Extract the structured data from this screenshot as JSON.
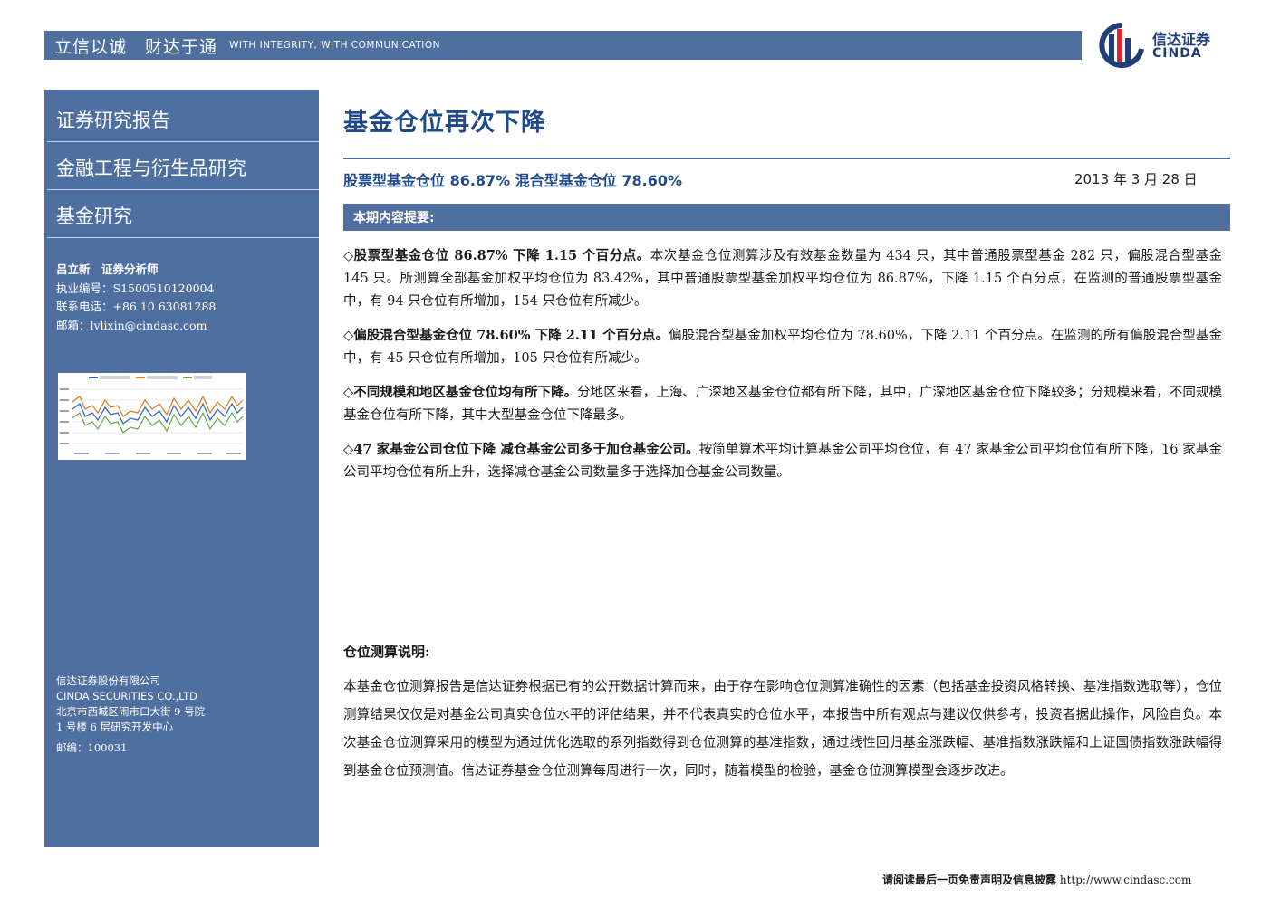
{
  "header": {
    "slogan_cn": "立信以诚　财达于通",
    "slogan_en": "WITH INTEGRITY, WITH COMMUNICATION",
    "logo_cn": "信达证券",
    "logo_en": "CINDA",
    "logo_colors": {
      "blue": "#1f3f7a",
      "red": "#d9272e"
    }
  },
  "sidebar": {
    "titles": [
      "证券研究报告",
      "金融工程与衍生品研究",
      "基金研究"
    ],
    "analyst": {
      "name_line": "吕立新　证券分析师",
      "license": "执业编号：S1500510120004",
      "phone": "联系电话：+86 10 63081288",
      "email": "邮箱：lvlixin@cindasc.com"
    },
    "company": {
      "name_cn": "信达证券股份有限公司",
      "name_en": "CINDA SECURITIES CO.,LTD",
      "address1": "北京市西城区闹市口大街 9 号院",
      "address2": "1 号楼 6 层研究开发中心",
      "postcode": "邮编：100031"
    }
  },
  "report": {
    "title": "基金仓位再次下降",
    "subtitle": "股票型基金仓位 86.87%  混合型基金仓位 78.60%",
    "date": "2013 年 3 月 28 日",
    "summary_heading": "本期内容提要:",
    "bullets": [
      {
        "lead": "◇股票型基金仓位 86.87% 下降 1.15 个百分点。",
        "text": "本次基金仓位测算涉及有效基金数量为 434 只，其中普通股票型基金 282 只，偏股混合型基金 145 只。所测算全部基金加权平均仓位为 83.42%，其中普通股票型基金加权平均仓位为 86.87%，下降 1.15 个百分点，在监测的普通股票型基金中，有 94 只仓位有所增加，154 只仓位有所减少。"
      },
      {
        "lead": "◇偏股混合型基金仓位 78.60% 下降 2.11 个百分点。",
        "text": "偏股混合型基金加权平均仓位为 78.60%，下降 2.11 个百分点。在监测的所有偏股混合型基金中，有 45 只仓位有所增加，105 只仓位有所减少。"
      },
      {
        "lead": "◇不同规模和地区基金仓位均有所下降。",
        "text": "分地区来看，上海、广深地区基金仓位都有所下降，其中，广深地区基金仓位下降较多；分规模来看，不同规模基金仓位有所下降，其中大型基金仓位下降最多。"
      },
      {
        "lead": "◇47 家基金公司仓位下降 减仓基金公司多于加仓基金公司。",
        "text": "按简单算术平均计算基金公司平均仓位，有 47 家基金公司平均仓位有所下降，16 家基金公司平均仓位有所上升，选择减仓基金公司数量多于选择加仓基金公司数量。"
      }
    ],
    "method_title": "仓位测算说明:",
    "method_text": "本基金仓位测算报告是信达证券根据已有的公开数据计算而来，由于存在影响仓位测算准确性的因素（包括基金投资风格转换、基准指数选取等），仓位测算结果仅仅是对基金公司真实仓位水平的评估结果，并不代表真实的仓位水平，本报告中所有观点与建议仅供参考，投资者据此操作，风险自负。本次基金仓位测算采用的模型为通过优化选取的系列指数得到仓位测算的基准指数，通过线性回归基金涨跌幅、基准指数涨跌幅和上证国债指数涨跌幅得到基金仓位预测值。信达证券基金仓位测算每周进行一次，同时，随着模型的检验，基金仓位测算模型会逐步改进。"
  },
  "footer": {
    "disclaimer": "请阅读最后一页免责声明及信息披露",
    "url": "http://www.cindasc.com"
  },
  "theme": {
    "primary": "#4e6fa0",
    "title_blue": "#1f4a8a"
  }
}
